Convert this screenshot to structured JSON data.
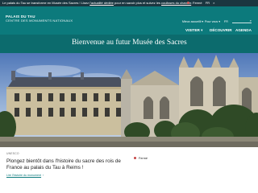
{
  "topbar": {
    "message_prefix": "Le palais du Tau se transforme en Musée des Sacres ! Lisez ",
    "link1": "l'actualité dédiée",
    "message_middle": " pour en savoir plus et suivez les ",
    "link2": "coulisses du chantier",
    "message_end": ".",
    "status_label": "Fermé",
    "status_color": "#d25757",
    "language": "FR",
    "close": "×"
  },
  "header": {
    "logo_line1": "PALAIS DU TAU",
    "logo_line2": "CENTRE DES MONUMENTS NATIONAUX",
    "select_visit": "Mieux accueilli",
    "select_practical": "Pour vous",
    "select_lang": "FR",
    "search_icon": "magnifier",
    "nav": [
      {
        "label": "VISITER",
        "chevron": "▾"
      },
      {
        "label": "DÉCOUVRIR"
      },
      {
        "label": "AGENDA"
      }
    ]
  },
  "banner": {
    "title": "Bienvenue au futur Musée des Sacres"
  },
  "card": {
    "kicker": "UNESCO",
    "headline": "Plongez bientôt dans l'histoire du sacre des rois de France au palais du Tau à Reims !",
    "link": "Lire l'histoire du monument",
    "link_arrow": "›",
    "status": "Fermé",
    "status_color": "#c64545"
  },
  "colors": {
    "brand_teal": "#0c7a7c",
    "banner_teal": "#0c6b6d",
    "topbar_dark": "#1b3640"
  }
}
